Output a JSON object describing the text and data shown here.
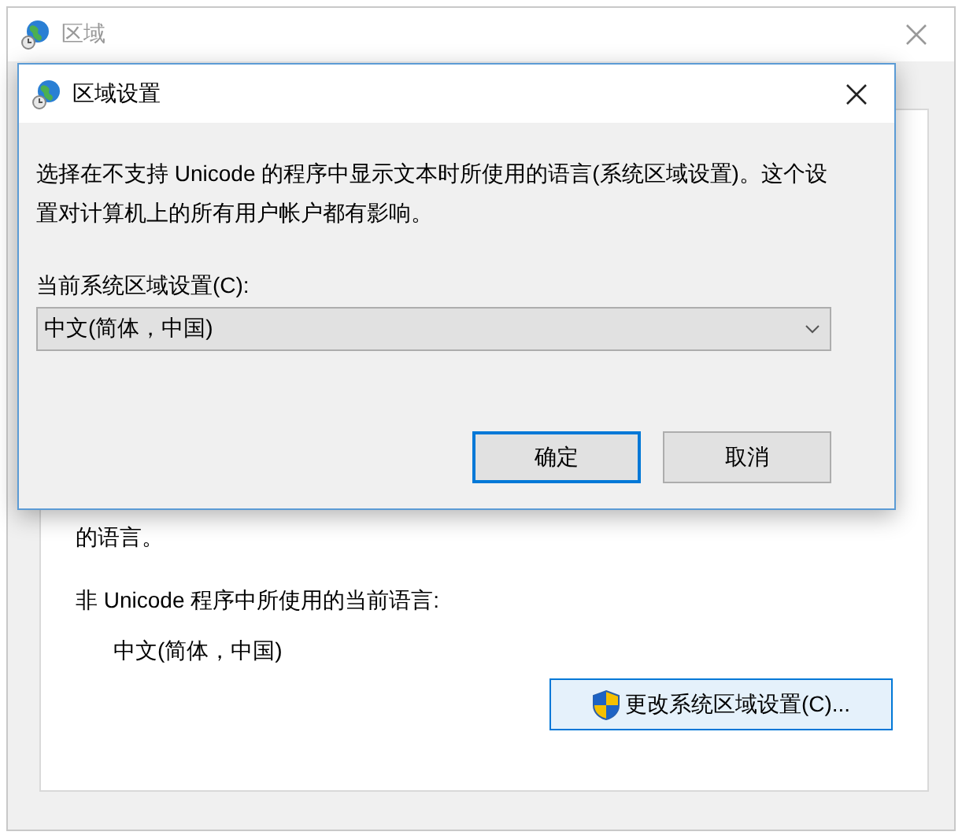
{
  "window": {
    "title": "区域"
  },
  "panel": {
    "visible_text": "的语言。",
    "current_language_label": "非 Unicode 程序中所使用的当前语言:",
    "current_language": "中文(简体，中国)",
    "change_button": "更改系统区域设置(C)..."
  },
  "dialog": {
    "title": "区域设置",
    "description": "选择在不支持 Unicode 的程序中显示文本时所使用的语言(系统区域设置)。这个设置对计算机上的所有用户帐户都有影响。",
    "locale_label": "当前系统区域设置(C):",
    "locale_value": "中文(简体，中国)",
    "buttons": [
      {
        "label": "确定",
        "default": true
      },
      {
        "label": "取消",
        "default": false
      }
    ]
  }
}
